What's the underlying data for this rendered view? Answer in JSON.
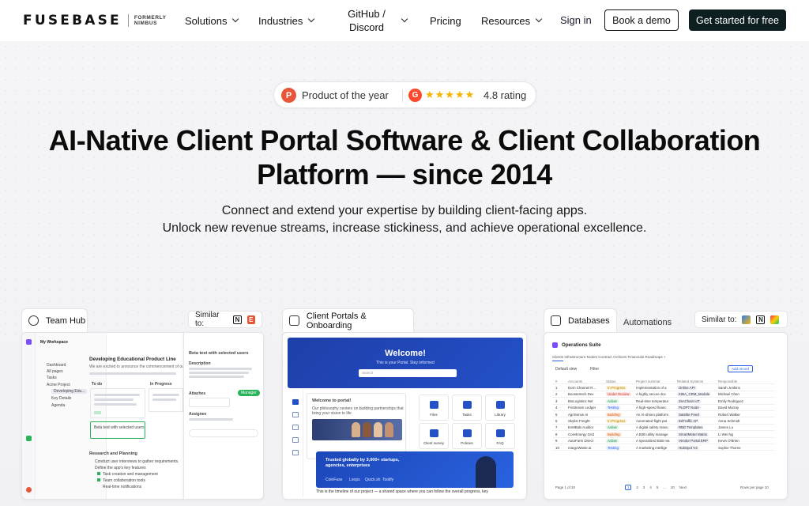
{
  "nav": {
    "logo": "FUSEBASE",
    "formerly_line1": "FORMERLY",
    "formerly_line2": "NIMBUS",
    "items": [
      "Solutions",
      "Industries",
      "GitHub /",
      "Discord",
      "Pricing",
      "Resources"
    ],
    "sign_in": "Sign in",
    "book_demo": "Book a demo",
    "get_started": "Get started for free"
  },
  "badge": {
    "ph_letter": "P",
    "product_of_year": "Product of the year",
    "g2_letter": "G",
    "stars": "★★★★★",
    "rating": "4.8 rating"
  },
  "hero": {
    "title_line1": "AI-Native Client Portal Software & Client Collaboration",
    "title_line2": "Platform — since 2014",
    "sub_line1": "Connect and extend your expertise by building client-facing apps.",
    "sub_line2": "Unlock new revenue streams, increase stickiness, and achieve operational excellence."
  },
  "cards": {
    "team_hub": {
      "tab": "Team Hub",
      "similar_to": "Similar to:",
      "workspace": "My Workspace",
      "tree": [
        "Dashboard",
        "All pages",
        "Tasks",
        "Acme Project",
        "Developing Edu...",
        "Key Details",
        "Agenda"
      ],
      "doc_title": "Developing Educational Product Line",
      "doc_intro": "We are excited to announce the commencement of our",
      "col_todo": "To do",
      "col_progress": "In Progress",
      "beta_item": "Beta test with selected users",
      "research": "Research and Planning",
      "checklist": [
        "Conduct user interviews to gather requirements.",
        "Define the app's key features",
        "Task creation and management",
        "Team collaboration tools",
        "Real-time notifications"
      ],
      "panel_title": "Beta test with selected users",
      "panel_desc": "Description",
      "panel_attach": "Attaches",
      "panel_assign": "Assignee",
      "manager": "Manager"
    },
    "portals": {
      "tab": "Client Portals & Onboarding",
      "welcome": "Welcome!",
      "portal_line": "This is your Portal. Stay informed",
      "search_ph": "Search",
      "welcome_box": "Welcome to portal!",
      "welcome_box_text": "Our philosophy centers on building partnerships that bring your vision to life",
      "tiles": [
        "Files",
        "Tasks",
        "Library",
        "Client survey",
        "Policies",
        "FAQ"
      ],
      "trust": "Trusted globally by 3,000+ startups, agencies, enterprises",
      "trust_logos": [
        "CoinFuse",
        "Loops",
        "Quick.sh",
        "Toolify"
      ],
      "timeline": "This is the timeline of our project — a shared space where you can follow the overall progress, key"
    },
    "databases": {
      "tab": "Databases",
      "tab2": "Automations",
      "similar_to": "Similar to:",
      "title": "Operations Suite",
      "tabs": "Clients   Infrastructure Nodes   Contract Archives   Financials   Roadmaps   +",
      "default_view": "Default view",
      "filter": "Filter",
      "add_record": "Add record",
      "headers": [
        "#",
        "Accounts",
        "Status",
        "Project summar",
        "Related Systems",
        "Responsible"
      ],
      "rows": [
        [
          "1",
          "Dorn Channel R...",
          "In Progress",
          "Implementation of a",
          "Online API",
          "Sarah Jenkins"
        ],
        [
          "2",
          "Boostertech Dev",
          "Under Review",
          "A highly secure doc",
          "KIBA_CRM_Module",
          "Michael Chen"
        ],
        [
          "3",
          "BioLogistics Net",
          "Active",
          "Real-time temperatur",
          "ZenChain IoT",
          "Emily Rodriguez"
        ],
        [
          "4",
          "FinStream Ledger",
          "Testing",
          "A high-speed financ",
          "PLDPT Node",
          "David Murray"
        ],
        [
          "5",
          "AgriSense AI",
          "Building",
          "An AI-driven platform",
          "Satelite Feed",
          "Robert Walker"
        ],
        [
          "6",
          "Skylist Freight",
          "In Progress",
          "Automated flight pat",
          "EdTraffic AP",
          "Anna Schmidt"
        ],
        [
          "7",
          "EvMBals Auditor",
          "Active",
          "A digital safety manu",
          "RBD Templates",
          "James Lu"
        ],
        [
          "8",
          "CoreEnergy Grid",
          "Building",
          "A B2B utility manage",
          "SmartMeter Matrix",
          "Li Wei Ng"
        ],
        [
          "9",
          "AutoFarm Direct",
          "Active",
          "A specialized B2B ma",
          "Vendor Portal ERP",
          "Kevin O'Brien"
        ],
        [
          "10",
          "margoWaste.ai",
          "Testing",
          "A marketing intellige",
          "HubSpot V3",
          "Sophie Thorne"
        ]
      ],
      "page": "Page 1 of 20",
      "pages": [
        "1",
        "2",
        "3",
        "4",
        "5",
        "...",
        "20",
        "Next"
      ],
      "rows_per_page": "Rows per page 10"
    }
  },
  "colors": {
    "primary_dark": "#0e1f22",
    "portal_blue": "#2450c8",
    "ph_orange": "#e8563a",
    "g2_red": "#ff492c",
    "star_gold": "#f5b400",
    "green": "#29b35a"
  }
}
